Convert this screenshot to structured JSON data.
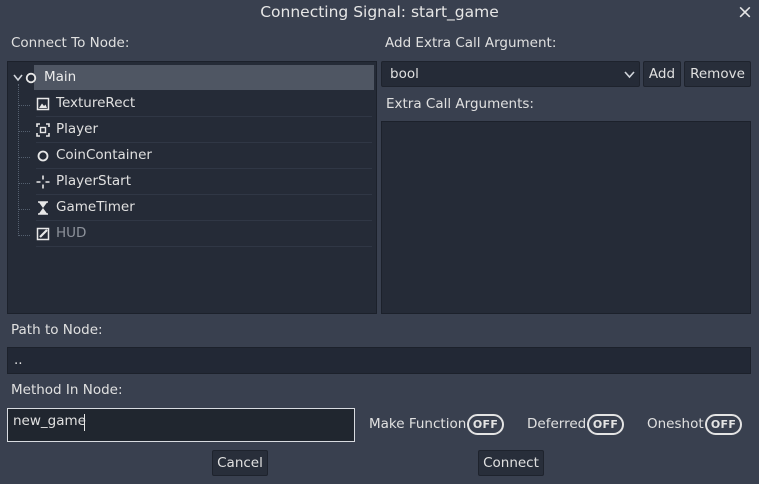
{
  "dialog": {
    "title": "Connecting Signal: start_game",
    "close_icon": "×"
  },
  "left": {
    "heading": "Connect To Node:",
    "tree": [
      {
        "label": "Main",
        "icon": "node-circle-icon",
        "selected": true,
        "expanded": true
      },
      {
        "label": "TextureRect",
        "icon": "texture-rect-icon"
      },
      {
        "label": "Player",
        "icon": "area-node-icon"
      },
      {
        "label": "CoinContainer",
        "icon": "node-circle-icon"
      },
      {
        "label": "PlayerStart",
        "icon": "position-icon"
      },
      {
        "label": "GameTimer",
        "icon": "timer-icon"
      },
      {
        "label": "HUD",
        "icon": "canvas-layer-icon",
        "disabled": true
      }
    ]
  },
  "right": {
    "heading": "Add Extra Call Argument:",
    "type_selected": "bool",
    "add_label": "Add",
    "remove_label": "Remove",
    "args_heading": "Extra Call Arguments:"
  },
  "path": {
    "label": "Path to Node:",
    "value": ".."
  },
  "method": {
    "label": "Method In Node:",
    "value": "new_game"
  },
  "toggles": [
    {
      "label": "Make Function",
      "state": "OFF"
    },
    {
      "label": "Deferred",
      "state": "OFF"
    },
    {
      "label": "Oneshot",
      "state": "OFF"
    }
  ],
  "footer": {
    "cancel_label": "Cancel",
    "connect_label": "Connect"
  },
  "colors": {
    "background": "#39404f",
    "panel": "#252b37",
    "selection": "#4f5663",
    "text": "#e0e0e0"
  }
}
